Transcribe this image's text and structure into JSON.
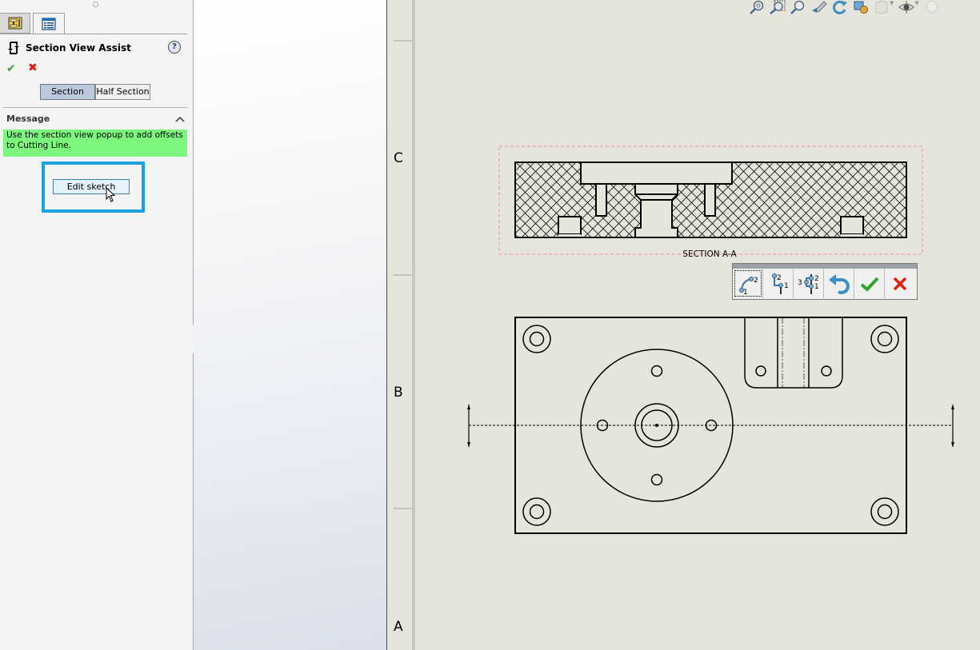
{
  "property_manager": {
    "tabs": [
      {
        "name": "property-manager-tab",
        "icon": "property-manager-icon"
      },
      {
        "name": "configuration-tab",
        "icon": "list-icon"
      }
    ],
    "title": "Section View Assist",
    "title_icon": "section-view-icon",
    "help_label": "?",
    "ok_label": "✔",
    "cancel_label": "✖",
    "mode_options": [
      "Section",
      "Half Section"
    ],
    "selected_mode": "Section",
    "message_header": "Message",
    "message_text": "Use the section view popup to add offsets to Cutting Line.",
    "edit_sketch_label": "Edit sketch"
  },
  "view_toolbar": {
    "icons": [
      "zoom-to-fit-icon",
      "zoom-to-area-icon",
      "zoom-in-out-icon",
      "previous-view-icon",
      "redraw-icon",
      "display-style-icon",
      "view-orientation-icon",
      "hide-show-items-icon",
      "apply-scene-icon"
    ]
  },
  "sheet": {
    "zones": [
      "C",
      "B",
      "A"
    ],
    "section_label": "SECTION A-A"
  },
  "section_popup": {
    "buttons": [
      {
        "name": "arc-offset",
        "icon": "arc-offset-icon"
      },
      {
        "name": "single-offset",
        "icon": "single-offset-icon"
      },
      {
        "name": "notch-offset",
        "icon": "notch-offset-icon"
      },
      {
        "name": "undo",
        "icon": "undo-icon"
      },
      {
        "name": "accept",
        "icon": "check-icon"
      },
      {
        "name": "cancel",
        "icon": "close-icon"
      }
    ]
  },
  "colors": {
    "accent_highlight": "#1aa3e0",
    "message_bg": "#7cf87e",
    "sheet_bg": "#e6e5dc",
    "ok_green": "#3aa33a",
    "cancel_red": "#e0200c",
    "view_boundary": "#f08cb8"
  }
}
